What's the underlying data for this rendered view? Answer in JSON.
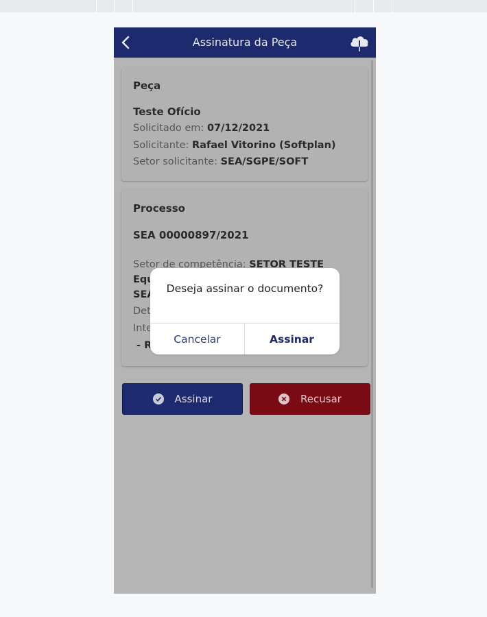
{
  "header": {
    "title": "Assinatura da Peça"
  },
  "piece_card": {
    "heading": "Peça",
    "name": "Teste Ofício",
    "requested_label": "Solicitado em: ",
    "requested_value": "07/12/2021",
    "requester_label": "Solicitante: ",
    "requester_value": "Rafael Vitorino (Softplan)",
    "sector_label": "Setor solicitante: ",
    "sector_value": "SEA/SGPE/SOFT"
  },
  "process_card": {
    "heading": "Processo",
    "number": "SEA 00000897/2021",
    "competence_label": "Setor de competência: ",
    "competence_value": "SETOR TESTE",
    "line2": "Equ",
    "line3": "SEA",
    "line4": "Det",
    "line5": "Inte",
    "line6": " - R"
  },
  "actions": {
    "sign_label": "Assinar",
    "refuse_label": "Recusar"
  },
  "dialog": {
    "message": "Deseja assinar o documento?",
    "cancel_label": "Cancelar",
    "confirm_label": "Assinar"
  },
  "colors": {
    "primary": "#1d2b6e",
    "danger": "#7a0a14",
    "overlay_bg": "#b5b5b5",
    "dialog_bg": "#ffffff"
  },
  "icons": {
    "back": "chevron-left-icon",
    "download": "cloud-download-icon",
    "sign": "check-circle-icon",
    "refuse": "x-circle-icon"
  }
}
